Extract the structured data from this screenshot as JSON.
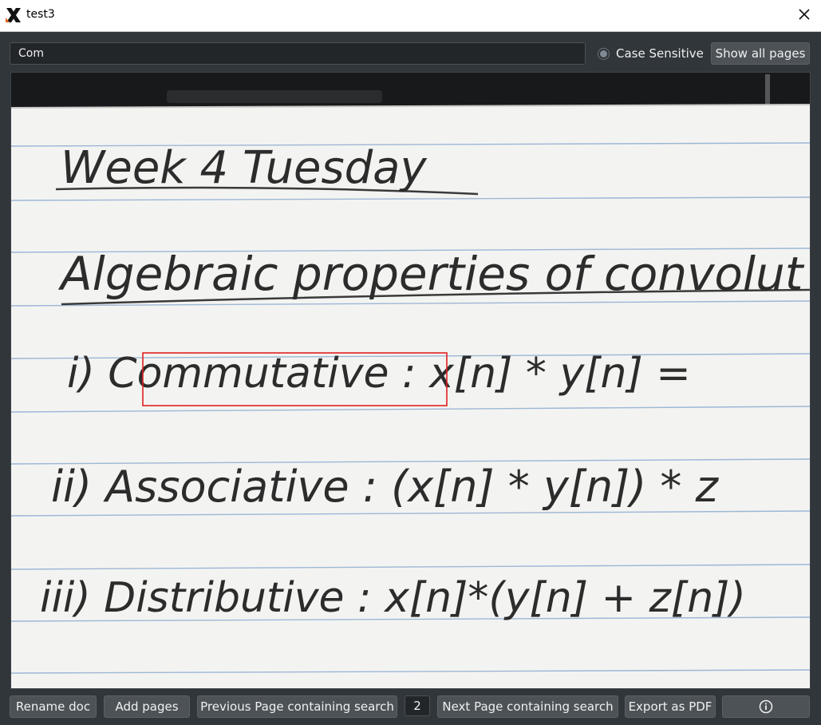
{
  "window": {
    "title": "test3",
    "app_icon": "x-logo-icon",
    "close_icon": "close-icon"
  },
  "search": {
    "value": "Com",
    "case_sensitive_label": "Case Sensitive",
    "show_all_pages_label": "Show all pages"
  },
  "page": {
    "lines": [
      "Week 4 Tuesday",
      "Algebraic properties of convolut",
      "i) Commutative :  x[n] * y[n] =",
      "ii) Associative :  (x[n] * y[n]) * z",
      "iii) Distributive :  x[n]*(y[n] + z[n])"
    ],
    "highlight": "Commutative :"
  },
  "footer": {
    "rename_label": "Rename doc",
    "add_pages_label": "Add pages",
    "prev_label": "Previous Page containing search",
    "page_number": "2",
    "next_label": "Next Page containing search",
    "export_label": "Export as PDF",
    "info_icon": "info-icon"
  },
  "colors": {
    "background": "#31363b",
    "highlight_box": "#e02020",
    "paper": "#f3f4f1",
    "rule_line": "#9db6d6"
  }
}
